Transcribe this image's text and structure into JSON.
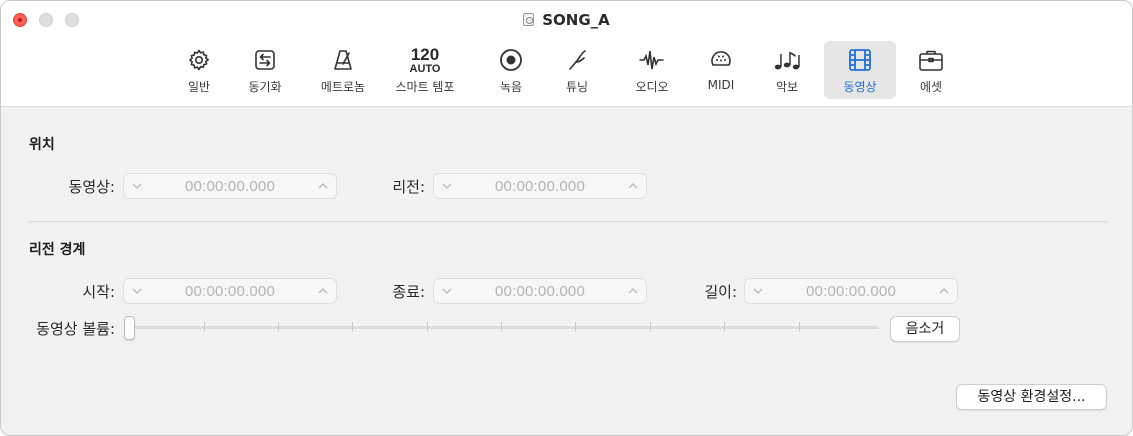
{
  "window": {
    "title": "SONG_A"
  },
  "toolbar": {
    "tabs": [
      {
        "label": "일반",
        "icon": "gear-icon"
      },
      {
        "label": "동기화",
        "icon": "sync-icon"
      },
      {
        "label": "메트로놈",
        "icon": "metronome-icon"
      },
      {
        "label": "스마트 템포",
        "icon": "tempo-icon",
        "icon_text": "120",
        "icon_subtext": "AUTO"
      },
      {
        "label": "녹음",
        "icon": "record-icon"
      },
      {
        "label": "튜닝",
        "icon": "tuning-fork-icon"
      },
      {
        "label": "오디오",
        "icon": "waveform-icon"
      },
      {
        "label": "MIDI",
        "icon": "midi-icon"
      },
      {
        "label": "악보",
        "icon": "notes-icon"
      },
      {
        "label": "동영상",
        "icon": "film-icon",
        "selected": true
      },
      {
        "label": "에셋",
        "icon": "briefcase-icon"
      }
    ]
  },
  "position_section": {
    "title": "위치",
    "movie_label": "동영상:",
    "movie_value": "00:00:00.000",
    "region_label": "리전:",
    "region_value": "00:00:00.000"
  },
  "region_bounds_section": {
    "title": "리전 경계",
    "start_label": "시작:",
    "start_value": "00:00:00.000",
    "end_label": "종료:",
    "end_value": "00:00:00.000",
    "length_label": "길이:",
    "length_value": "00:00:00.000"
  },
  "volume": {
    "label": "동영상 볼륨:",
    "level": 0,
    "mute_label": "음소거"
  },
  "footer": {
    "settings_button": "동영상 환경설정..."
  },
  "colors": {
    "accent": "#1f6fd6",
    "close": "#ff5f57",
    "panel": "#f2f2f2"
  }
}
